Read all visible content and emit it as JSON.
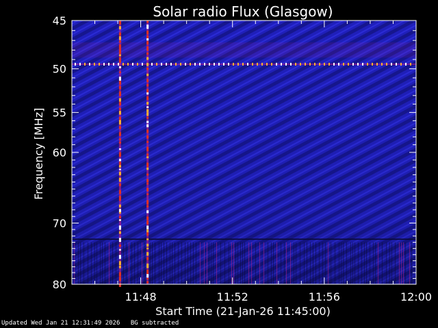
{
  "chart_data": {
    "type": "heatmap",
    "title": "Solar radio Flux (Glasgow)",
    "xlabel": "Start Time (21-Jan-26 11:45:00)",
    "ylabel": "Frequency [MHz]",
    "x_tick_labels": [
      "11:48",
      "11:52",
      "11:56",
      "12:00"
    ],
    "x_tick_minutes": [
      3,
      7,
      11,
      15
    ],
    "xlim_minutes": [
      0,
      15
    ],
    "y_ticks": [
      45,
      50,
      55,
      60,
      70,
      80
    ],
    "ylim": [
      45,
      80
    ],
    "y_scale": "log",
    "grid": false,
    "colormap": [
      "#0a0a33",
      "#1c1cb4",
      "#3030e0",
      "#b0208a",
      "#e03020",
      "#ffb030",
      "#ffffff"
    ],
    "features": {
      "interference_band_mhz": 49.5,
      "bursts_minutes": [
        2.1,
        3.3
      ],
      "burst_band_mhz": [
        45,
        80
      ]
    }
  },
  "footer": {
    "updated": "Updated Wed Jan 21 12:31:49 2026",
    "bg_note": "BG subtracted"
  }
}
